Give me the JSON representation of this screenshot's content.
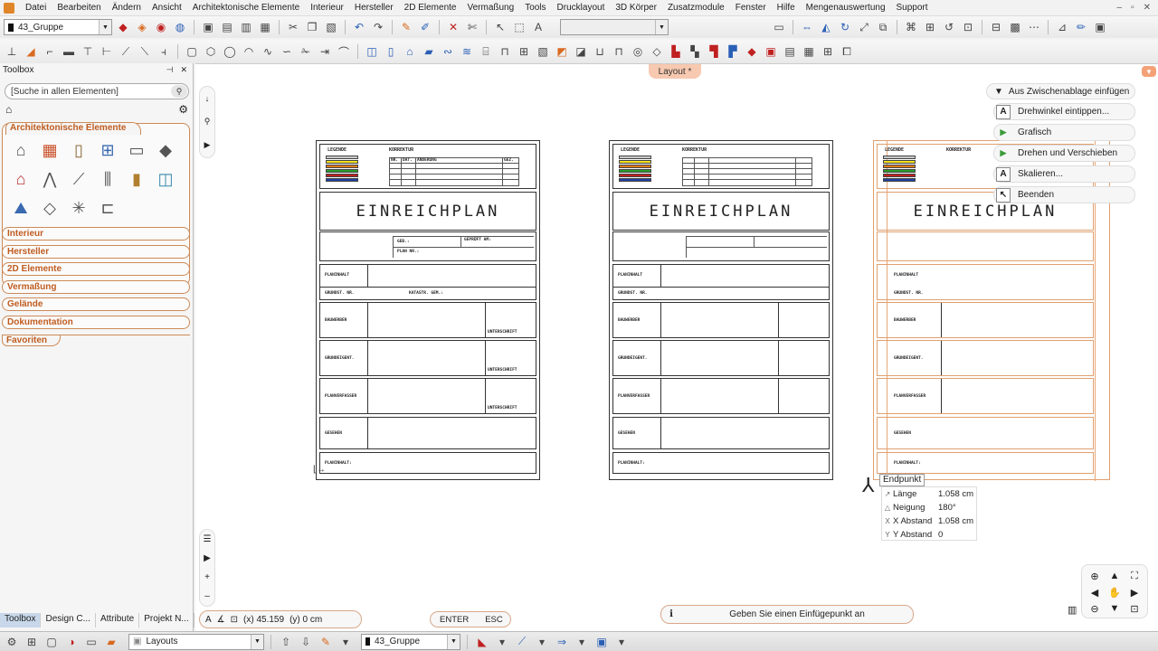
{
  "menu": [
    "Datei",
    "Bearbeiten",
    "Ändern",
    "Ansicht",
    "Architektonische Elemente",
    "Interieur",
    "Hersteller",
    "2D Elemente",
    "Vermaßung",
    "Tools",
    "Drucklayout",
    "3D Körper",
    "Zusatzmodule",
    "Fenster",
    "Hilfe",
    "Mengenauswertung",
    "Support"
  ],
  "toolbar": {
    "layer_value": "43_Gruppe"
  },
  "toolbox": {
    "title": "Toolbox",
    "search_placeholder": "[Suche in allen Elementen]",
    "open_category": "Architektonische Elemente",
    "categories": [
      "Interieur",
      "Hersteller",
      "2D Elemente",
      "Vermaßung",
      "Gelände",
      "Dokumentation"
    ],
    "favorites": "Favoriten",
    "tabs": [
      "Toolbox",
      "Design C...",
      "Attribute",
      "Projekt N..."
    ]
  },
  "canvas": {
    "layout_tab": "Layout *"
  },
  "plan": {
    "legend": "LEGENDE",
    "korrektur": "KORREKTUR",
    "korr_headers": [
      "NR.",
      "DAT.",
      "ÄNDERUNG",
      "GEZ."
    ],
    "title": "EINREICHPLAN",
    "geb": "GEB.:",
    "plan_nr": "PLAN NR.:",
    "gepruft": "GEPRÜFT AM:",
    "planinhalt": "PLANINHALT",
    "grundst": "GRUNDST. NR.",
    "katastr": "KATASTR. GEM.:",
    "bauwerber": "BAUWERBER",
    "unterschrift": "UNTERSCHRIFT",
    "grundeigent": "GRUNDEIGENT.",
    "planverfasser": "PLANVERFASSER",
    "gesehen": "GESEHEN",
    "planinhalt2": "PLANINHALT:"
  },
  "context_menu": {
    "header": "Aus Zwischenablage einfügen",
    "items": [
      "Drehwinkel eintippen...",
      "Grafisch",
      "Drehen und Verschieben",
      "Skalieren...",
      "Beenden"
    ]
  },
  "snap": {
    "label": "Endpunkt",
    "rows": [
      {
        "label": "Länge",
        "value": "1.058 cm"
      },
      {
        "label": "Neigung",
        "value": "180°"
      },
      {
        "label": "X Abstand",
        "value": "1.058 cm"
      },
      {
        "label": "Y Abstand",
        "value": "0"
      }
    ]
  },
  "coords": {
    "x": "(x) 45.159",
    "y": "(y) 0 cm"
  },
  "keys": {
    "enter": "ENTER",
    "esc": "ESC"
  },
  "message": "Geben Sie einen Einfügepunkt an",
  "statusbar": {
    "layout_combo": "Layouts",
    "layer_combo": "43_Gruppe"
  },
  "colors": {
    "accent": "#c05c20",
    "panel_border": "#cd8a57",
    "legend_stripes": [
      "#c8c8c8",
      "#f2e11a",
      "#e07a1a",
      "#2a9a2a",
      "#c02020",
      "#2040a0"
    ]
  }
}
